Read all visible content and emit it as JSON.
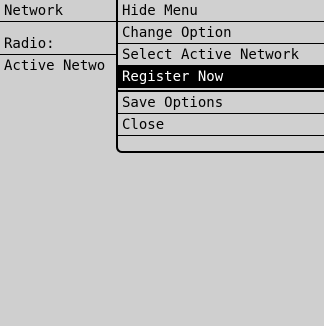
{
  "background": {
    "rows": [
      {
        "label": "Network"
      },
      {
        "label": "Radio:"
      },
      {
        "label": "Active Netwo"
      }
    ]
  },
  "menu": {
    "items": [
      {
        "label": "Hide Menu",
        "selected": false
      },
      {
        "label": "Change Option",
        "selected": false
      },
      {
        "label": "Select Active Network",
        "selected": false
      },
      {
        "label": "Register Now",
        "selected": true
      },
      {
        "label": "Save Options",
        "selected": false
      },
      {
        "label": "Close",
        "selected": false
      }
    ]
  },
  "colors": {
    "background": "#cfcfcf",
    "text": "#000000",
    "highlight": "#000000",
    "highlight_text": "#ffffff"
  }
}
